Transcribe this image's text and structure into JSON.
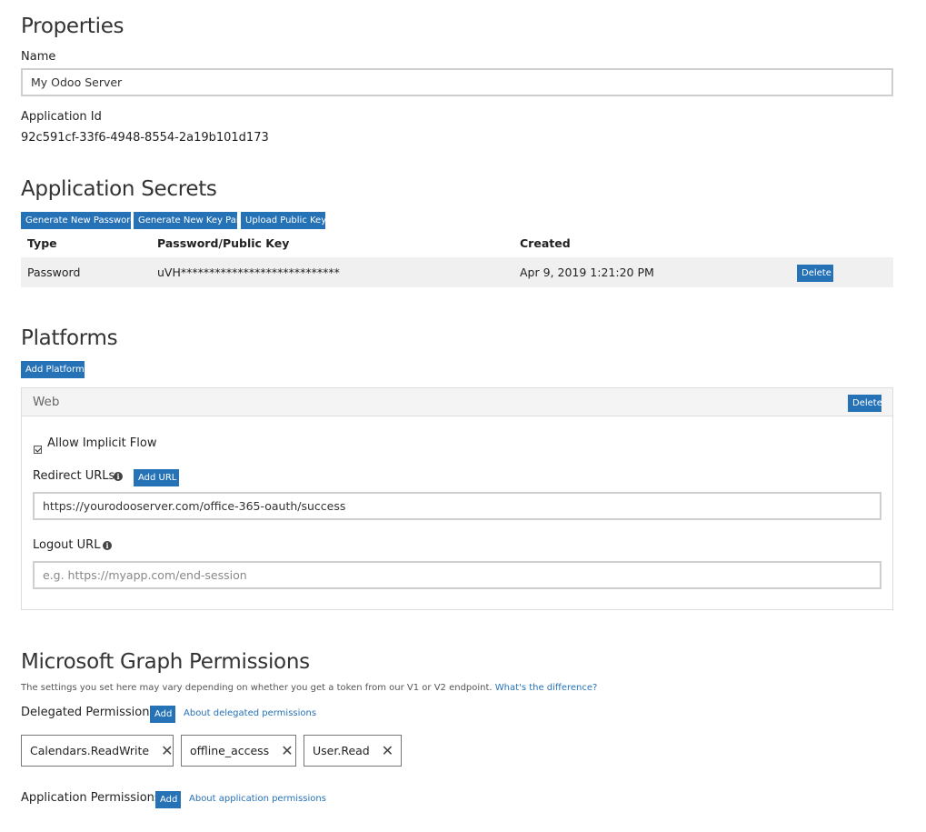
{
  "properties": {
    "title": "Properties",
    "name_label": "Name",
    "name_value": "My Odoo Server",
    "app_id_label": "Application Id",
    "app_id_value": "92c591cf-33f6-4948-8554-2a19b101d173"
  },
  "secrets": {
    "title": "Application Secrets",
    "buttons": {
      "generate_password": "Generate New Password",
      "generate_keypair": "Generate New Key Pair",
      "upload_key": "Upload Public Key"
    },
    "columns": [
      "Type",
      "Password/Public Key",
      "Created"
    ],
    "rows": [
      {
        "type": "Password",
        "key": "uVH****************************",
        "created": "Apr 9, 2019 1:21:20 PM",
        "delete_label": "Delete"
      }
    ]
  },
  "platforms": {
    "title": "Platforms",
    "add_label": "Add Platform",
    "web": {
      "title": "Web",
      "delete_label": "Delete",
      "implicit_flow_label": "Allow Implicit Flow",
      "implicit_flow_checked": true,
      "redirect_label": "Redirect URLs",
      "add_url_label": "Add URL",
      "redirect_value": "https://yourodooserver.com/office-365-oauth/success",
      "logout_label": "Logout URL",
      "logout_placeholder": "e.g. https://myapp.com/end-session"
    }
  },
  "graph": {
    "title": "Microsoft Graph Permissions",
    "note": "The settings you set here may vary depending on whether you get a token from our V1 or V2 endpoint.",
    "note_link": "What's the difference?",
    "delegated_label": "Delegated Permissions",
    "add_label": "Add",
    "delegated_link": "About delegated permissions",
    "delegated_items": [
      "Calendars.ReadWrite",
      "offline_access",
      "User.Read"
    ],
    "application_label": "Application Permissions",
    "application_link": "About application permissions"
  },
  "colors": {
    "accent": "#2672b7",
    "row_bg": "#f0f0f0",
    "panel_header_bg": "#f4f4f4"
  }
}
